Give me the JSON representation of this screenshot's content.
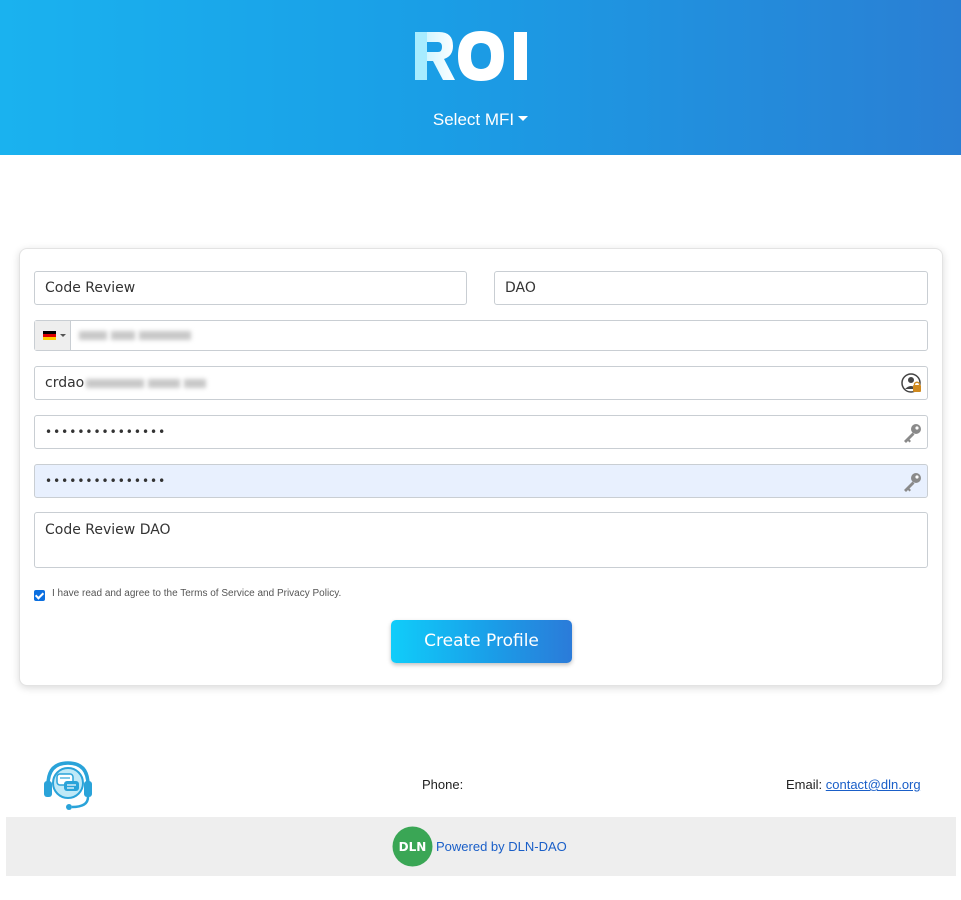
{
  "header": {
    "logo_text": "ROI",
    "mfi_selector_label": "Select MFI"
  },
  "form": {
    "first_name_value": "Code Review",
    "last_name_value": "DAO",
    "phone_country": "DE",
    "email_value_visible": "crdao",
    "password_masked": "•••••••••••••••",
    "confirm_password_masked": "•••••••••••••••",
    "description_value": "Code Review DAO",
    "agree_checked": true,
    "agree_text": "I have read and agree to the Terms of Service and Privacy Policy.",
    "submit_label": "Create Profile"
  },
  "footer": {
    "phone_label": "Phone:",
    "email_label": "Email:",
    "email_link": "contact@dln.org",
    "powered_by": "Powered by DLN-DAO",
    "dln_logo_text": "DLN"
  },
  "colors": {
    "header_gradient_start": "#1ab2ef",
    "header_gradient_end": "#2a7fd4",
    "button_gradient_start": "#10cdfa",
    "button_gradient_end": "#2b7bd9",
    "link": "#1a5fc8",
    "dln_green": "#3aa655"
  },
  "icons": {
    "support": "support-chat-headset-icon",
    "password_key": "key-icon",
    "email_lock": "user-lock-icon",
    "checkbox": "checkbox-checked-icon"
  }
}
